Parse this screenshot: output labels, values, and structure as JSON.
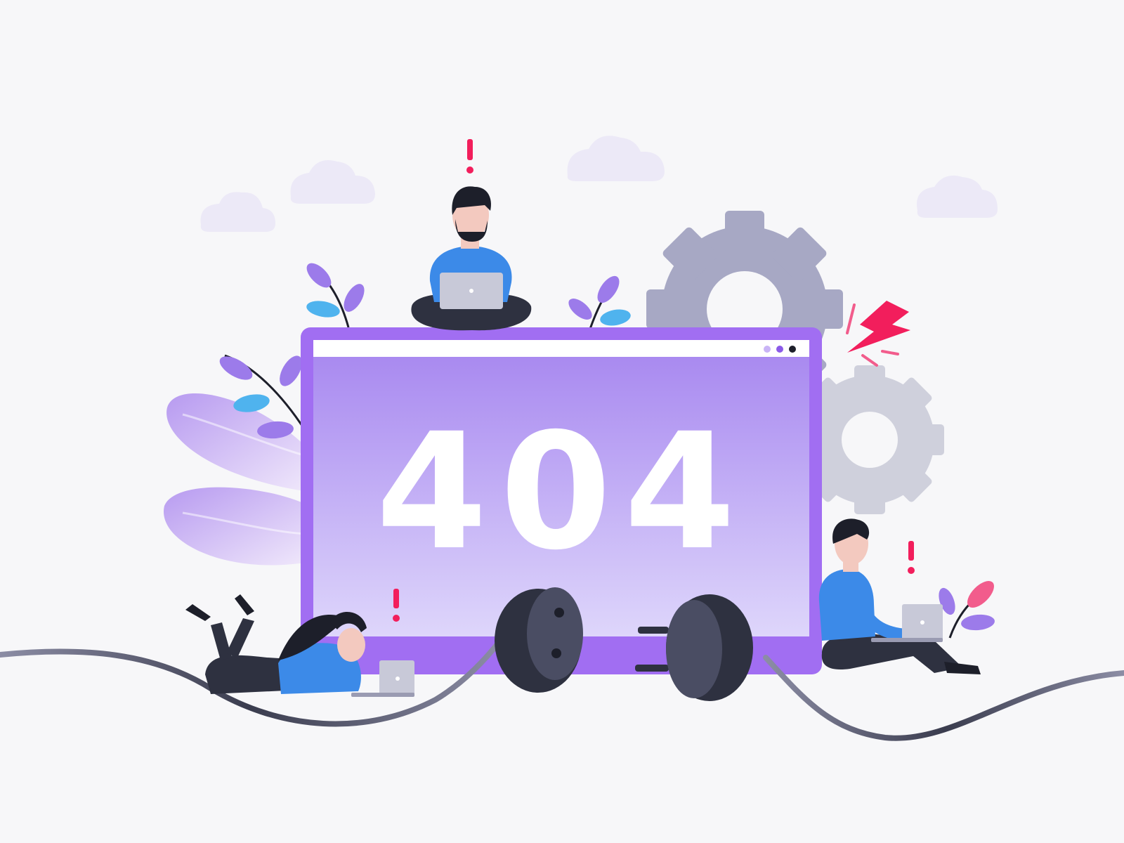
{
  "illustration": {
    "error_code": "404",
    "alert_mark": "!",
    "colors": {
      "background": "#f7f7f9",
      "monitor_frame": "#a16ef2",
      "screen_top": "#a98af0",
      "screen_bottom": "#ded6fb",
      "gear_large": "#a7a8c4",
      "gear_small": "#cfd0dc",
      "cloud": "#ece9f7",
      "alert_red": "#f21e5c",
      "shirt_blue": "#3c8ae8",
      "pants_dark": "#2e3140",
      "plug_dark": "#4a4d63",
      "cable": "#6f7088",
      "leaf_purple": "#9c7bea",
      "leaf_blue": "#4fb3ee",
      "leaf_pink": "#f25c8c",
      "laptop": "#c8c9d8"
    },
    "icons": [
      "gear-icon",
      "lightning-icon",
      "plug-icon",
      "socket-icon",
      "cloud-icon",
      "leaf-icon",
      "laptop-icon"
    ]
  }
}
